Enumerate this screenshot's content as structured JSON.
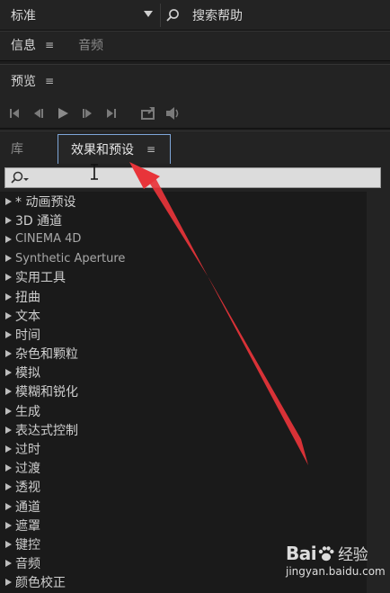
{
  "topbar": {
    "workspace_value": "标准",
    "search_help_label": "搜索帮助"
  },
  "info_panel": {
    "tabs": [
      {
        "label": "信息",
        "active": true
      },
      {
        "label": "音频",
        "active": false
      }
    ],
    "menu_glyph": "≡"
  },
  "preview_panel": {
    "title": "预览",
    "menu_glyph": "≡",
    "transport_icons": [
      "skip-to-start-icon",
      "step-back-icon",
      "play-icon",
      "step-forward-icon",
      "skip-to-end-icon",
      "loop-icon",
      "volume-icon"
    ]
  },
  "effects_panel": {
    "tabs": [
      {
        "label": "库",
        "active": false
      },
      {
        "label": "效果和预设",
        "active": true
      }
    ],
    "menu_glyph": "≡",
    "search": {
      "value": "",
      "placeholder": ""
    },
    "tree_items": [
      "* 动画预设",
      "3D 通道",
      "CINEMA 4D",
      "Synthetic Aperture",
      "实用工具",
      "扭曲",
      "文本",
      "时间",
      "杂色和颗粒",
      "模拟",
      "模糊和锐化",
      "生成",
      "表达式控制",
      "过时",
      "过渡",
      "透视",
      "通道",
      "遮罩",
      "键控",
      "音频",
      "颜色校正"
    ]
  },
  "colors": {
    "panel_bg": "#232323",
    "list_bg": "#1a1a1a",
    "active_tab_border": "#7ea6d8",
    "annotation_arrow": "#e8343a"
  },
  "watermark": {
    "brand": "Bai",
    "brand_suffix": "经验",
    "url": "jingyan.baidu.com"
  }
}
